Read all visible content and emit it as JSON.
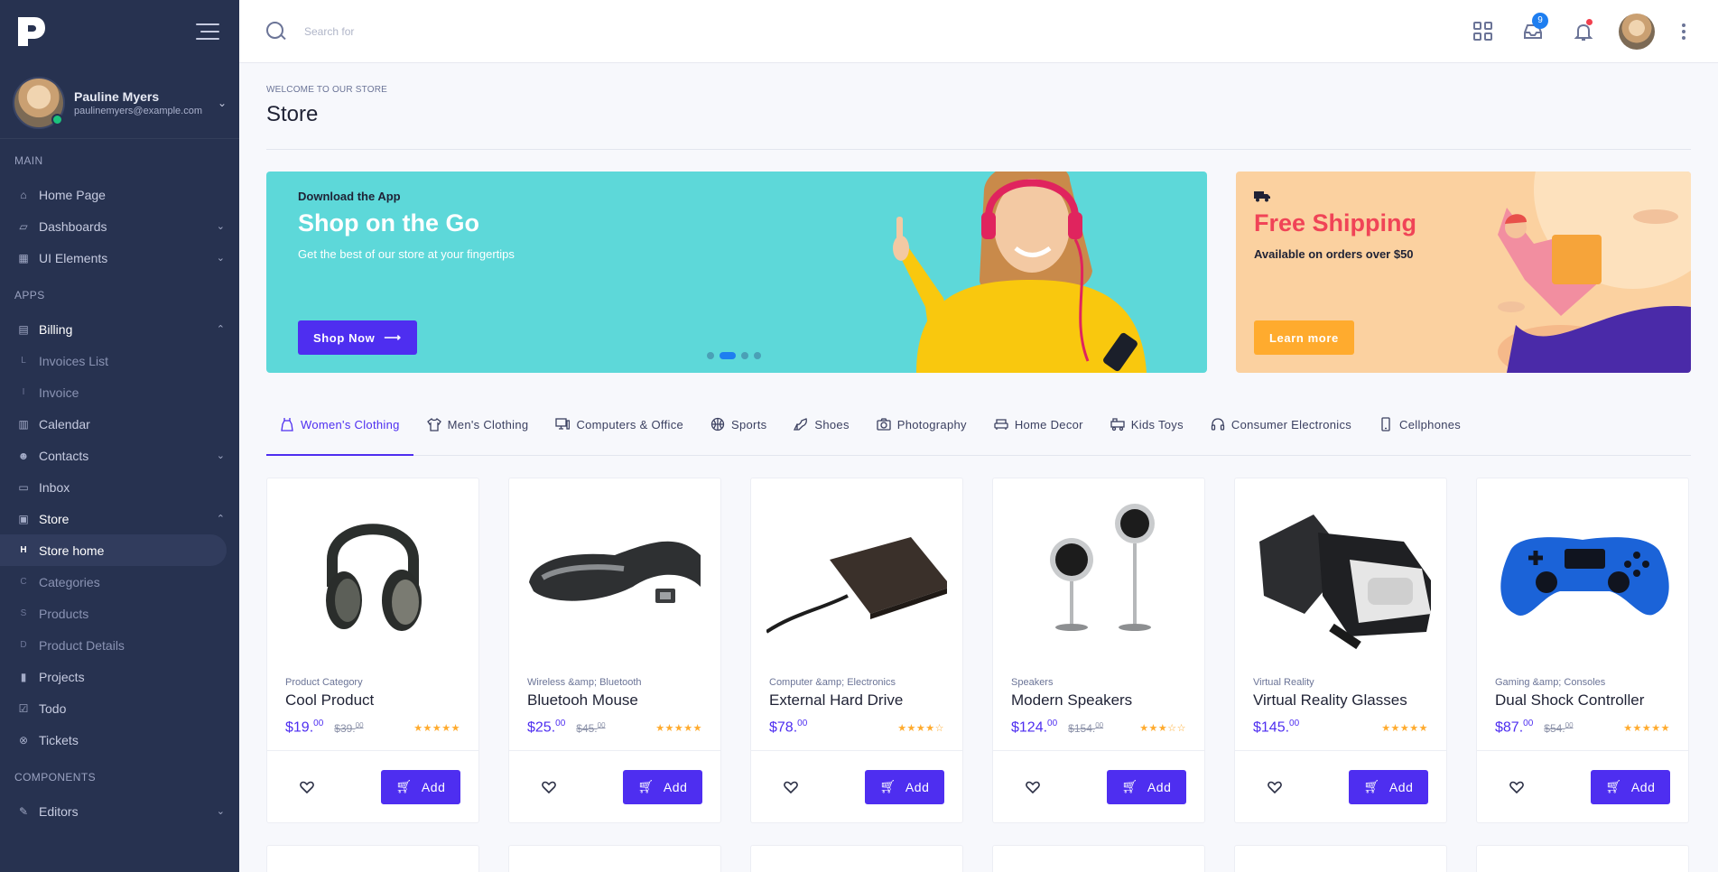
{
  "sidebar": {
    "user": {
      "name": "Pauline Myers",
      "email": "paulinemyers@example.com"
    },
    "sections": {
      "main": "MAIN",
      "apps": "APPS",
      "components": "COMPONENTS"
    },
    "items": {
      "home": "Home Page",
      "dashboards": "Dashboards",
      "ui_elements": "UI Elements",
      "billing": "Billing",
      "invoices_list": "Invoices List",
      "invoice": "Invoice",
      "calendar": "Calendar",
      "contacts": "Contacts",
      "inbox": "Inbox",
      "store": "Store",
      "store_home": "Store home",
      "categories": "Categories",
      "products": "Products",
      "product_details": "Product Details",
      "projects": "Projects",
      "todo": "Todo",
      "tickets": "Tickets",
      "editors": "Editors"
    },
    "sub_icons": {
      "invoices_list": "L",
      "invoice": "I",
      "store_home": "H",
      "categories": "C",
      "products": "S",
      "product_details": "D"
    }
  },
  "topbar": {
    "search_placeholder": "Search for",
    "inbox_badge": "9"
  },
  "page": {
    "breadcrumb": "WELCOME TO OUR STORE",
    "title": "Store"
  },
  "banner_app": {
    "eyebrow": "Download the App",
    "title": "Shop on the Go",
    "subtitle": "Get the best of our store at your fingertips",
    "button": "Shop Now"
  },
  "banner_shipping": {
    "title": "Free Shipping",
    "subtitle": "Available on orders over $50",
    "button": "Learn more"
  },
  "tabs": [
    {
      "label": "Women's Clothing"
    },
    {
      "label": "Men's Clothing"
    },
    {
      "label": "Computers & Office"
    },
    {
      "label": "Sports"
    },
    {
      "label": "Shoes"
    },
    {
      "label": "Photography"
    },
    {
      "label": "Home Decor"
    },
    {
      "label": "Kids Toys"
    },
    {
      "label": "Consumer Electronics"
    },
    {
      "label": "Cellphones"
    }
  ],
  "products": [
    {
      "category": "Product Category",
      "name": "Cool Product",
      "price": "$19.",
      "price_cents": "00",
      "old_price": "$39.",
      "old_cents": "00",
      "stars": "★★★★★",
      "rating": 5,
      "add": "Add"
    },
    {
      "category": "Wireless &amp; Bluetooth",
      "name": "Bluetooh Mouse",
      "price": "$25.",
      "price_cents": "00",
      "old_price": "$45.",
      "old_cents": "00",
      "stars": "★★★★★",
      "rating": 5,
      "add": "Add"
    },
    {
      "category": "Computer &amp; Electronics",
      "name": "External Hard Drive",
      "price": "$78.",
      "price_cents": "00",
      "old_price": "",
      "old_cents": "",
      "stars": "★★★★☆",
      "rating": 4,
      "add": "Add"
    },
    {
      "category": "Speakers",
      "name": "Modern Speakers",
      "price": "$124.",
      "price_cents": "00",
      "old_price": "$154.",
      "old_cents": "00",
      "stars": "★★★☆☆",
      "rating": 3,
      "add": "Add"
    },
    {
      "category": "Virtual Reality",
      "name": "Virtual Reality Glasses",
      "price": "$145.",
      "price_cents": "00",
      "old_price": "",
      "old_cents": "",
      "stars": "★★★★★",
      "rating": 5,
      "add": "Add"
    },
    {
      "category": "Gaming &amp; Consoles",
      "name": "Dual Shock Controller",
      "price": "$87.",
      "price_cents": "00",
      "old_price": "$54.",
      "old_cents": "00",
      "stars": "★★★★★",
      "rating": 5,
      "add": "Add"
    }
  ],
  "colors": {
    "primary": "#4e2ef0",
    "sidebar": "#273250",
    "teal_banner": "#5dd8d9",
    "peach_banner": "#fbd1a0",
    "shipping_title": "#f04457",
    "orange_button": "#ffab2e"
  }
}
